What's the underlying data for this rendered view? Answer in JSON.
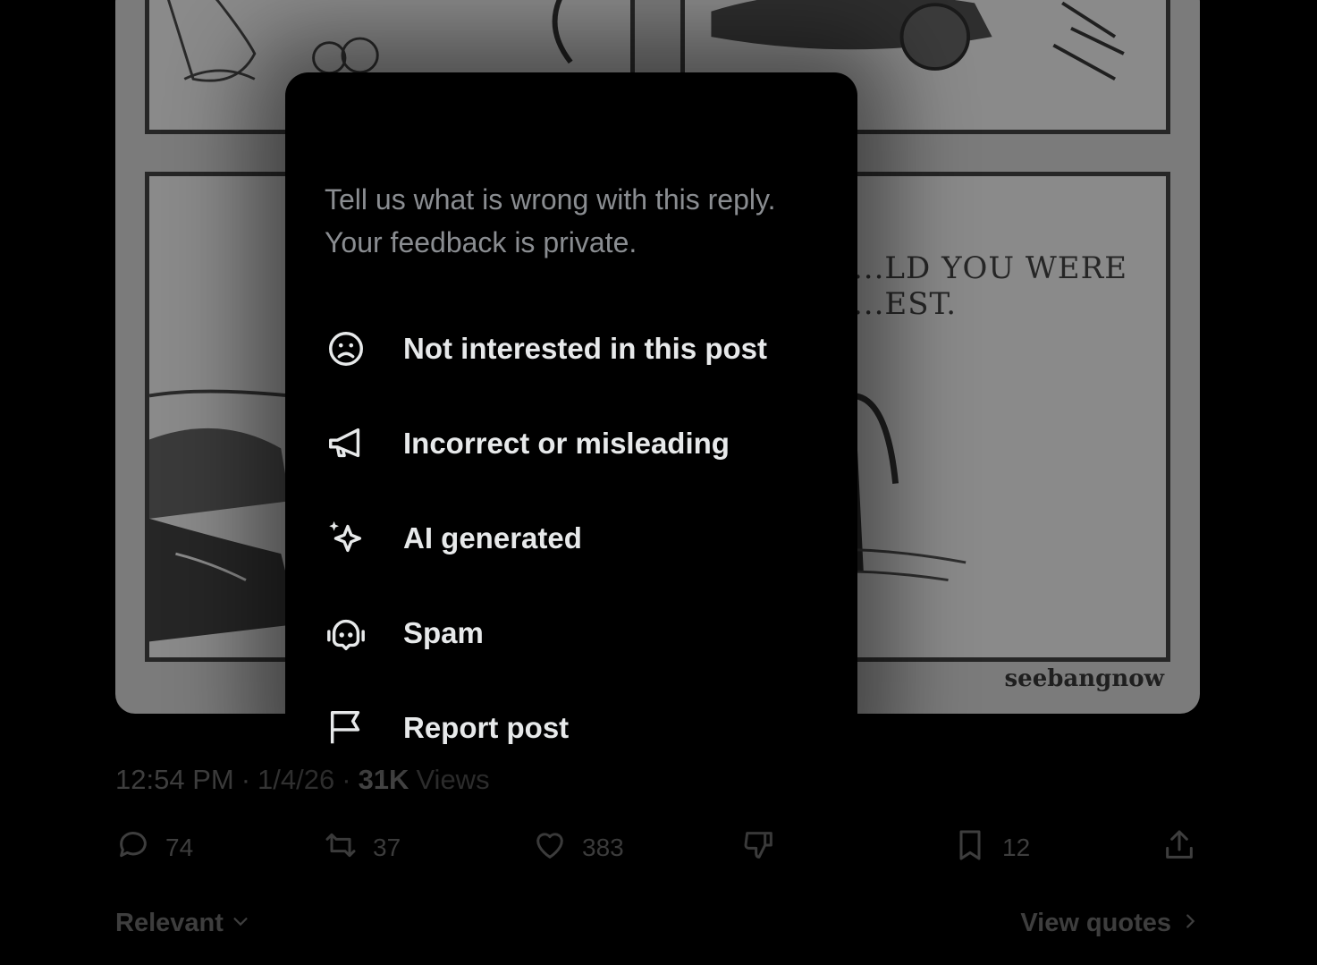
{
  "comic": {
    "caption": "...LD YOU WERE\n...EST.",
    "credit": "seebangnow"
  },
  "post": {
    "time": "12:54 PM",
    "date": "1/4/26",
    "separator": "·",
    "views_count": "31K",
    "views_label": "Views"
  },
  "actions": {
    "replies": "74",
    "reposts": "37",
    "likes": "383",
    "bookmarks": "12"
  },
  "footer": {
    "sort_label": "Relevant",
    "view_quotes_label": "View quotes"
  },
  "popup": {
    "description": "Tell us what is wrong with this reply. Your feedback is private.",
    "items": [
      {
        "label": "Not interested in this post",
        "icon": "frown-face-icon"
      },
      {
        "label": "Incorrect or misleading",
        "icon": "megaphone-icon"
      },
      {
        "label": "AI generated",
        "icon": "sparkle-icon"
      },
      {
        "label": "Spam",
        "icon": "robot-icon"
      },
      {
        "label": "Report post",
        "icon": "flag-icon"
      }
    ]
  },
  "colors": {
    "menu_text": "#e7e9ea",
    "muted_text": "#8a8d91",
    "dim_text": "#3e3e3e",
    "background": "#000000"
  }
}
